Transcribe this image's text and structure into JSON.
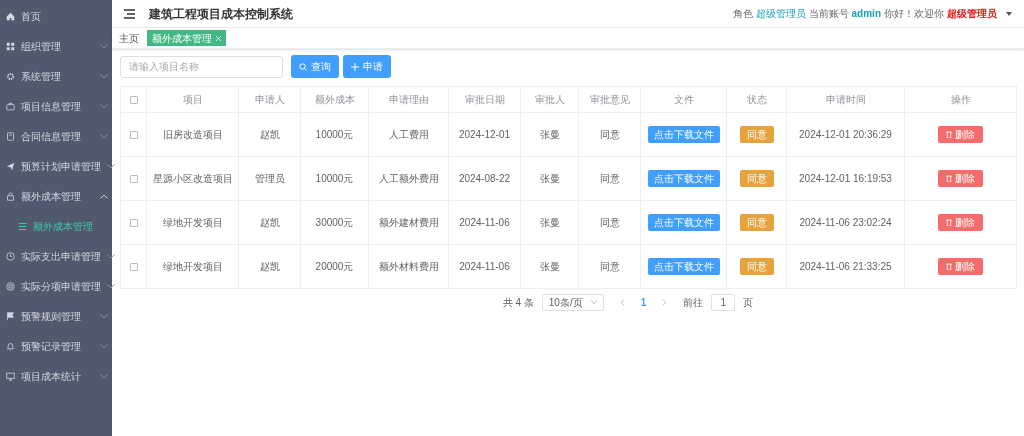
{
  "sidebar": {
    "items": [
      {
        "label": "首页",
        "selected": false
      },
      {
        "label": "组织管理",
        "expanded": false,
        "selected": false
      },
      {
        "label": "系统管理",
        "expanded": false,
        "selected": false
      },
      {
        "label": "项目信息管理",
        "expanded": false,
        "selected": false
      },
      {
        "label": "合同信息管理",
        "expanded": false,
        "selected": false
      },
      {
        "label": "预算计划申请管理",
        "expanded": false,
        "selected": false
      },
      {
        "label": "额外成本管理",
        "expanded": true,
        "selected": false,
        "children": [
          {
            "label": "额外成本管理",
            "selected": true
          }
        ]
      },
      {
        "label": "实际支出申请管理",
        "expanded": false,
        "selected": false
      },
      {
        "label": "实际分项申请管理",
        "expanded": false,
        "selected": false
      },
      {
        "label": "预警规则管理",
        "expanded": false,
        "selected": false
      },
      {
        "label": "预警记录管理",
        "expanded": false,
        "selected": false
      },
      {
        "label": "项目成本统计",
        "expanded": false,
        "selected": false
      }
    ]
  },
  "header": {
    "title": "建筑工程项目成本控制系统",
    "role_label": "角色",
    "role": "超级管理员",
    "account_label": "当前账号",
    "account": "admin",
    "greeting": "你好！欢迎你",
    "user": "超级管理员"
  },
  "tabs": [
    {
      "label": "主页",
      "selected": false
    },
    {
      "label": "额外成本管理",
      "selected": true
    }
  ],
  "search": {
    "placeholder": "请输入项目名称"
  },
  "buttons": [
    {
      "label": "查询"
    },
    {
      "label": "申请"
    }
  ],
  "table": {
    "all_checked": false,
    "columns": [
      "项目",
      "申请人",
      "额外成本",
      "申请理由",
      "审批日期",
      "审批人",
      "审批意见",
      "文件",
      "状态",
      "申请时间",
      "操作"
    ],
    "rows": [
      {
        "checked": false,
        "project": "旧房改造项目",
        "applicant": "赵凯",
        "cost": "10000元",
        "reason": "人工费用",
        "approve_date": "2024-12-01",
        "approver": "张曼",
        "opinion": "同意",
        "file": "点击下载文件",
        "status": "同意",
        "time": "2024-12-01 20:36:29",
        "action": "删除"
      },
      {
        "checked": false,
        "project": "星源小区改造项目",
        "applicant": "管理员",
        "cost": "10000元",
        "reason": "人工额外费用",
        "approve_date": "2024-08-22",
        "approver": "张曼",
        "opinion": "同意",
        "file": "点击下载文件",
        "status": "同意",
        "time": "2024-12-01 16:19:53",
        "action": "删除"
      },
      {
        "checked": false,
        "project": "绿地开发项目",
        "applicant": "赵凯",
        "cost": "30000元",
        "reason": "额外建材费用",
        "approve_date": "2024-11-06",
        "approver": "张曼",
        "opinion": "同意",
        "file": "点击下载文件",
        "status": "同意",
        "time": "2024-11-06 23:02:24",
        "action": "删除"
      },
      {
        "checked": false,
        "project": "绿地开发项目",
        "applicant": "赵凯",
        "cost": "20000元",
        "reason": "额外材料费用",
        "approve_date": "2024-11-06",
        "approver": "张曼",
        "opinion": "同意",
        "file": "点击下载文件",
        "status": "同意",
        "time": "2024-11-06 21:33:25",
        "action": "删除"
      }
    ]
  },
  "pagination": {
    "total": "共 4 条",
    "page_size": "10条/页",
    "current": "1",
    "goto_label": "前往",
    "goto_value": "1",
    "page_unit": "页"
  }
}
